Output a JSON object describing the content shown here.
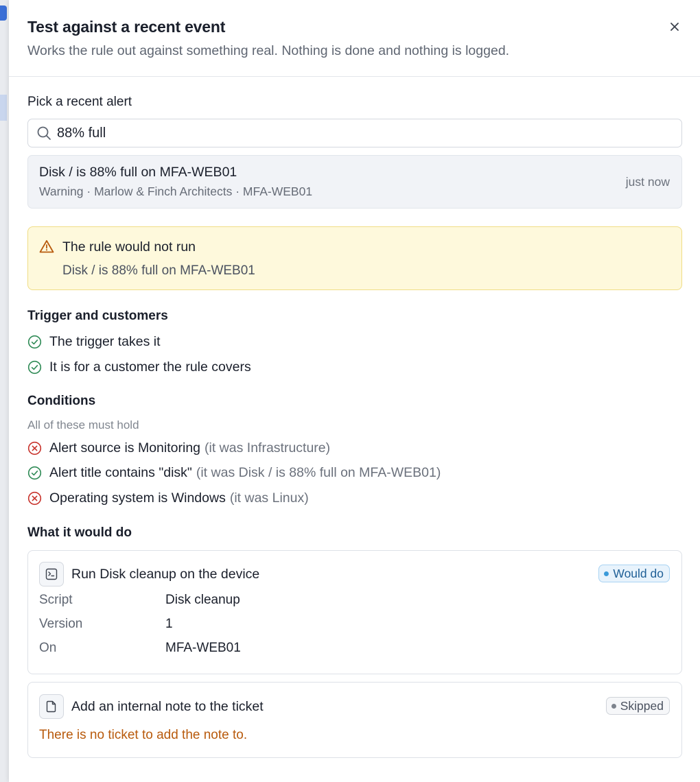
{
  "dialog": {
    "title": "Test against a recent event",
    "subtitle": "Works the rule out against something real. Nothing is done and nothing is logged.",
    "close_icon": "close-icon"
  },
  "picker": {
    "label": "Pick a recent alert",
    "search_value": "88% full",
    "result": {
      "title": "Disk / is 88% full on MFA-WEB01",
      "meta": "Warning · Marlow & Finch Architects · MFA-WEB01",
      "time": "just now"
    }
  },
  "verdict": {
    "title": "The rule would not run",
    "subtitle": "Disk / is 88% full on MFA-WEB01",
    "color": "#fef9dc"
  },
  "trigger": {
    "title": "Trigger and customers",
    "items": [
      {
        "text": "The trigger takes it",
        "status": "pass"
      },
      {
        "text": "It is for a customer the rule covers",
        "status": "pass"
      }
    ]
  },
  "conditions": {
    "title": "Conditions",
    "hint": "All of these must hold",
    "items": [
      {
        "text": "Alert source is Monitoring",
        "note": "(it was Infrastructure)",
        "status": "fail"
      },
      {
        "text": "Alert title contains \"disk\"",
        "note": "(it was Disk / is 88% full on MFA-WEB01)",
        "status": "pass"
      },
      {
        "text": "Operating system is Windows",
        "note": "(it was Linux)",
        "status": "fail"
      }
    ]
  },
  "actions": {
    "title": "What it would do",
    "run_script": {
      "title": "Run Disk cleanup on the device",
      "badge": "Would do",
      "rows": [
        {
          "key": "Script",
          "value": "Disk cleanup"
        },
        {
          "key": "Version",
          "value": "1"
        },
        {
          "key": "On",
          "value": "MFA-WEB01"
        }
      ]
    },
    "add_note": {
      "title": "Add an internal note to the ticket",
      "badge": "Skipped",
      "reason": "There is no ticket to add the note to."
    }
  },
  "colors": {
    "pass": "#2e8a55",
    "fail": "#c8322b",
    "warning": "#b85a0c",
    "accent": "#3a9ad9"
  }
}
